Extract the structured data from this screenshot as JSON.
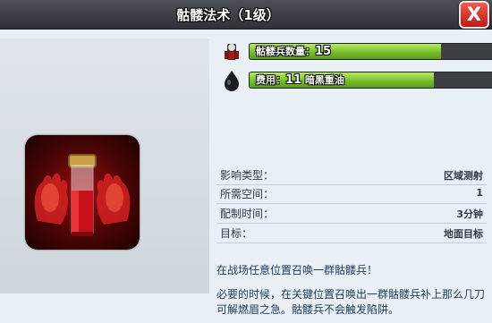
{
  "window": {
    "title": "骷髅法术（1级）",
    "close_label": "X"
  },
  "stats": [
    {
      "label": "骷髅兵数量：",
      "value": "15",
      "fill_percent": 78
    },
    {
      "label": "费用：",
      "value": "11",
      "suffix": " 暗黑重油",
      "fill_percent": 75
    }
  ],
  "info": [
    {
      "key": "影响类型：",
      "value": "区域测射"
    },
    {
      "key": "所需空间：",
      "value": "1"
    },
    {
      "key": "配制时间：",
      "value": "3分钟"
    },
    {
      "key": "目标：",
      "value": "地面目标"
    }
  ],
  "description": {
    "line1": "在战场任意位置召唤一群骷髅兵！",
    "line2": "必要的时候，在关键位置召唤出一群骷髅兵补上那么几刀可解燃眉之急。骷髅兵不会触发陷阱。"
  },
  "colors": {
    "bar_fill": "#78be2d",
    "bar_track": "#3d3f44",
    "close_button": "#d8322b"
  },
  "icons": [
    "skeleton-icon",
    "dark-elixir-icon",
    "skeleton-spell-icon",
    "close-icon"
  ]
}
